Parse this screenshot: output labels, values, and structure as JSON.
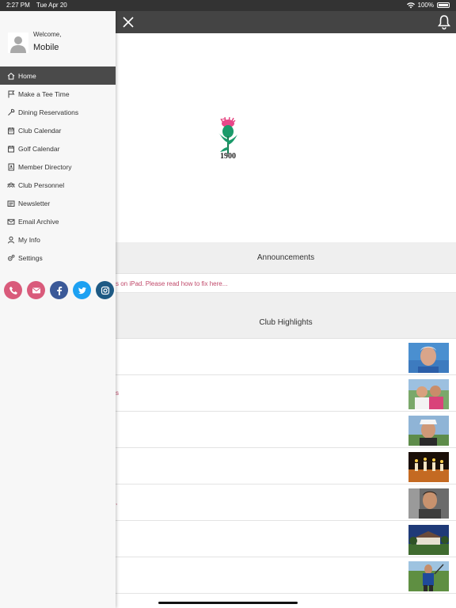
{
  "status_bar": {
    "time": "2:27 PM",
    "date": "Tue Apr 20",
    "battery": "100%"
  },
  "drawer": {
    "welcome": "Welcome,",
    "username": "Mobile",
    "menu": [
      {
        "label": "Home",
        "icon": "home-icon"
      },
      {
        "label": "Make a Tee Time",
        "icon": "flag-icon"
      },
      {
        "label": "Dining Reservations",
        "icon": "utensils-icon"
      },
      {
        "label": "Club Calendar",
        "icon": "calendar-icon"
      },
      {
        "label": "Golf Calendar",
        "icon": "calendar-icon"
      },
      {
        "label": "Member Directory",
        "icon": "directory-icon"
      },
      {
        "label": "Club Personnel",
        "icon": "people-icon"
      },
      {
        "label": "Newsletter",
        "icon": "newspaper-icon"
      },
      {
        "label": "Email Archive",
        "icon": "envelope-icon"
      },
      {
        "label": "My Info",
        "icon": "user-icon"
      },
      {
        "label": "Settings",
        "icon": "gears-icon"
      }
    ],
    "active_item": "Home",
    "social": [
      {
        "name": "phone-button",
        "icon": "phone-icon",
        "color": "#d95b7b"
      },
      {
        "name": "email-button",
        "icon": "envelope-icon",
        "color": "#d95b7b"
      },
      {
        "name": "facebook-button",
        "icon": "facebook-icon",
        "color": "#3b5998"
      },
      {
        "name": "twitter-button",
        "icon": "twitter-icon",
        "color": "#1da1f2"
      },
      {
        "name": "instagram-button",
        "icon": "instagram-icon",
        "color": "#1e5a84"
      }
    ]
  },
  "main": {
    "logo_year": "1900",
    "announcements": {
      "title": "Announcements",
      "text": "s on iPad. Please read how to fix here..."
    },
    "highlights": {
      "title": "Club Highlights",
      "rows": [
        {
          "mark": ""
        },
        {
          "mark": "s"
        },
        {
          "mark": ""
        },
        {
          "mark": ""
        },
        {
          "mark": ","
        },
        {
          "mark": ""
        },
        {
          "mark": ""
        }
      ]
    }
  },
  "colors": {
    "accent": "#c0496a",
    "appbar": "#444444",
    "drawer_active": "#4a4a4a"
  }
}
